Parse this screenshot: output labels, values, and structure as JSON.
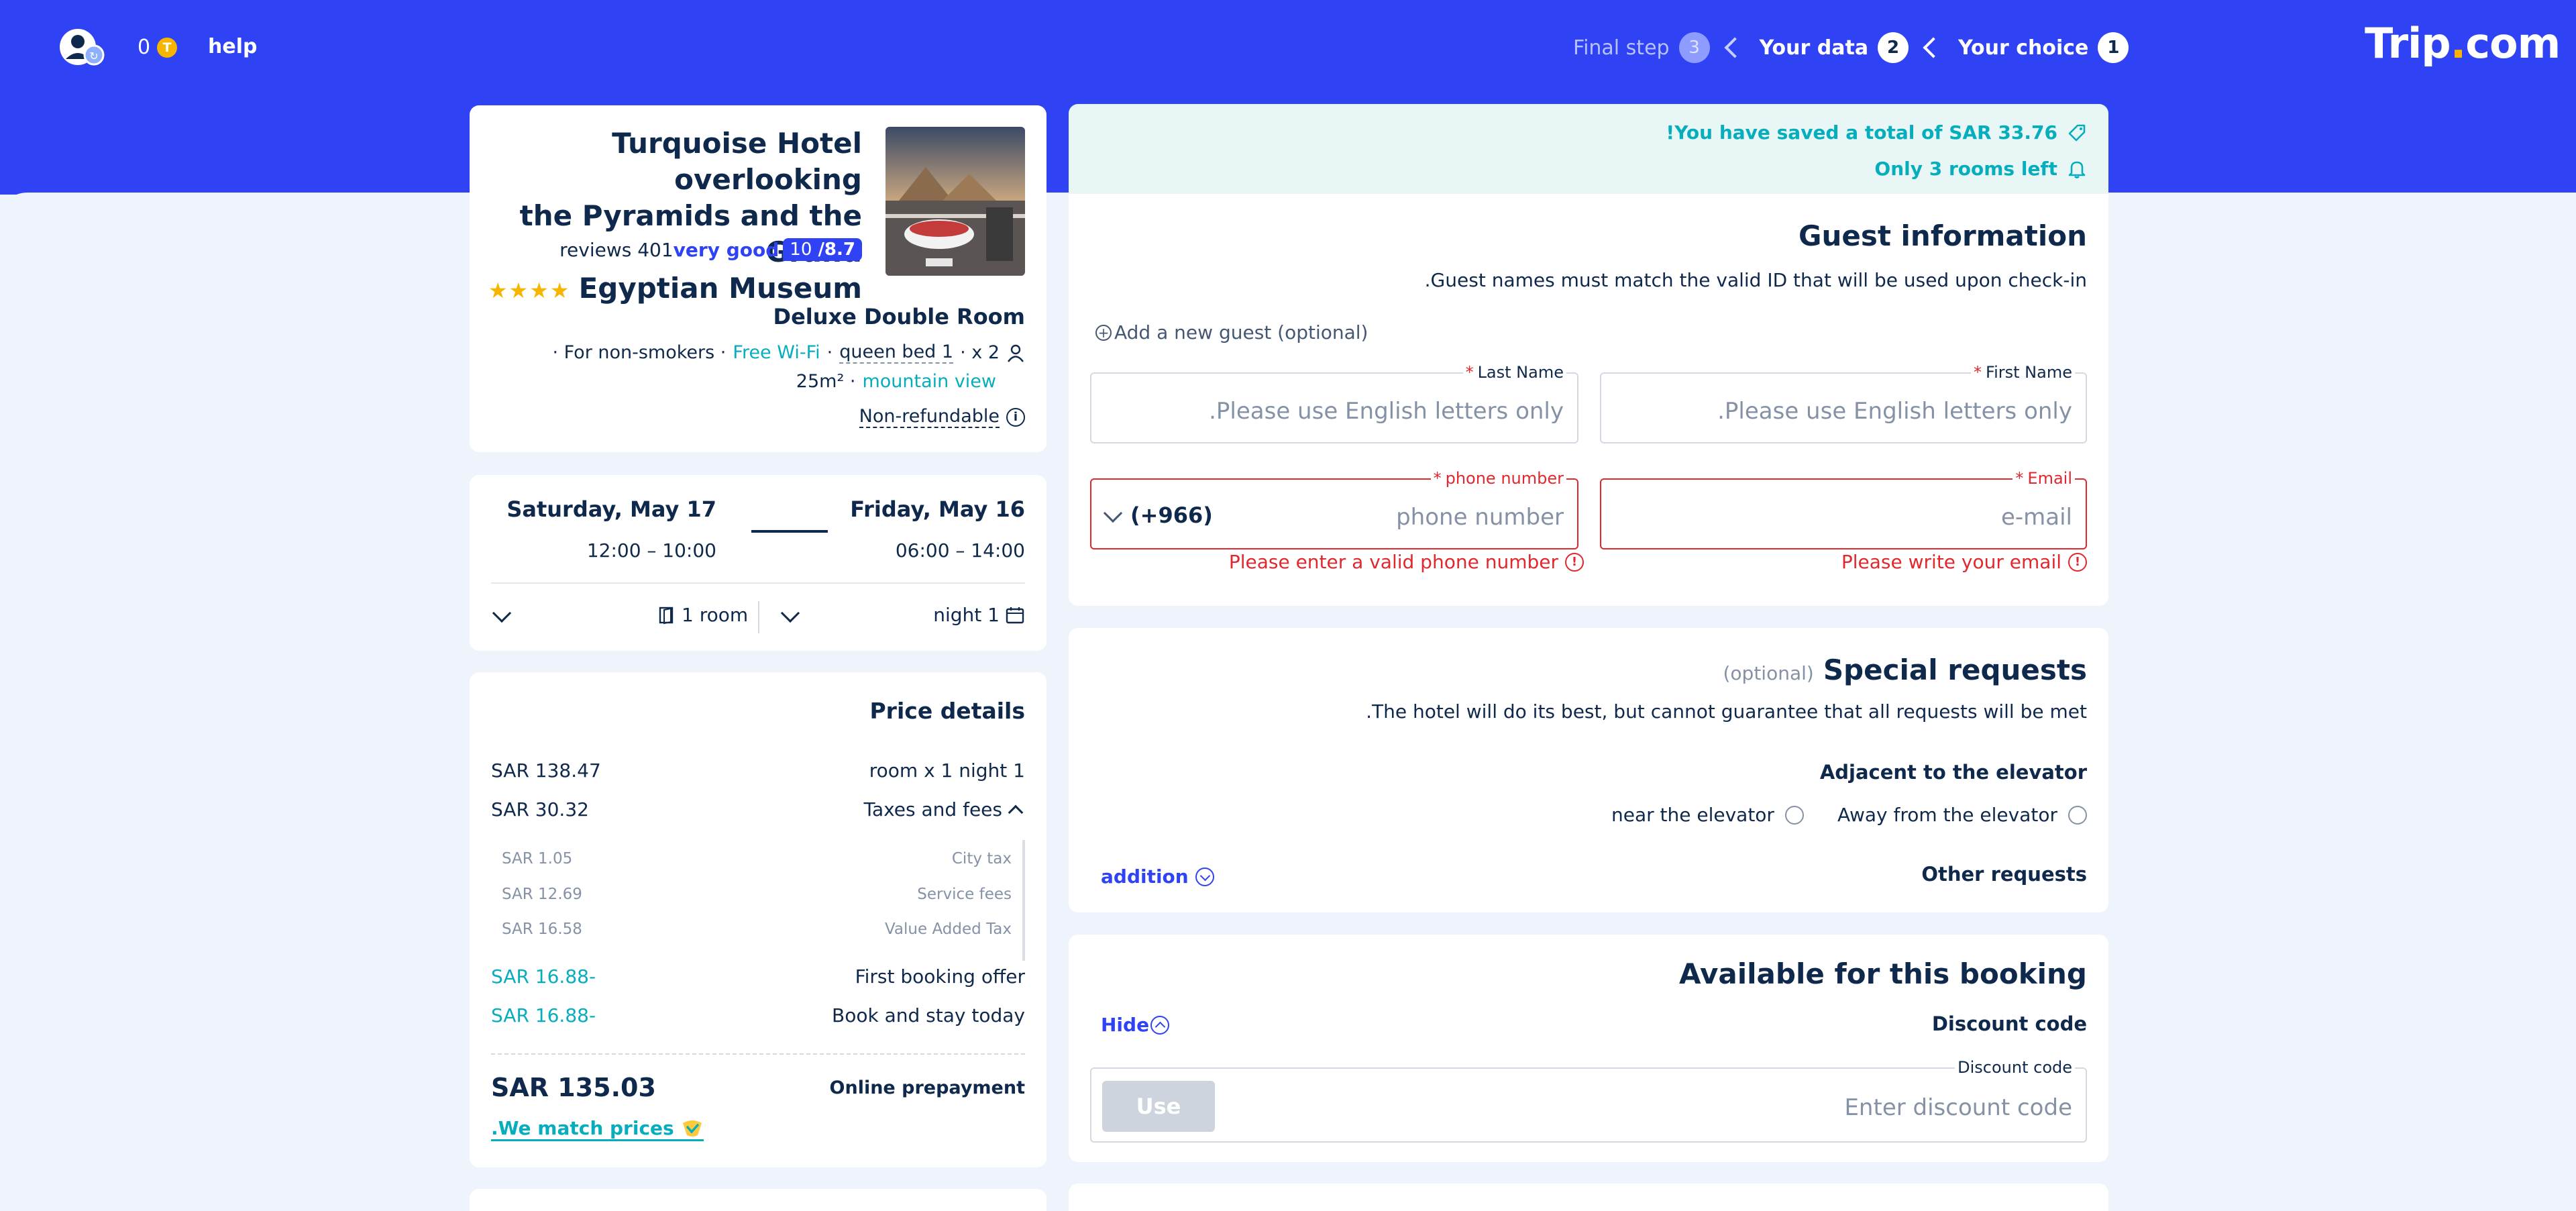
{
  "topbar": {
    "coins": "0",
    "coin_symbol": "T",
    "help": "help",
    "logo_main": "Trip",
    "logo_dot": ".",
    "logo_tail": "com",
    "steps": [
      {
        "label": "Final step",
        "num": "3"
      },
      {
        "label": "Your data",
        "num": "2"
      },
      {
        "label": "Your choice",
        "num": "1"
      }
    ]
  },
  "hotel": {
    "title_lines": [
      "Turquoise Hotel overlooking",
      "the Pyramids and the Grand",
      "Egyptian Museum"
    ],
    "stars": "★★★★",
    "reviews": "reviews 401",
    "rating_text": "very good",
    "score_max": "10",
    "score": "/8.7",
    "room_name": "Deluxe Double Room",
    "amenities": {
      "smoking": "· For non-smokers ·",
      "wifi": "Free Wi-Fi",
      "sep": "·",
      "bed": "queen bed 1",
      "guests": "· x 2",
      "size": "25m² ·",
      "view": "mountain view"
    },
    "refund": "Non-refundable",
    "refund_icon": "i"
  },
  "dates": {
    "checkin_day": "Saturday, May 17",
    "checkin_time": "12:00 – 10:00",
    "checkout_day": "Friday, May 16",
    "checkout_time": "06:00 – 14:00",
    "rooms": "1 room",
    "nights": "night 1"
  },
  "price": {
    "title": "Price details",
    "rows": [
      {
        "amount": "SAR 138.47",
        "label": "room x 1 night 1"
      },
      {
        "amount": "SAR 30.32",
        "label": "Taxes and fees"
      }
    ],
    "taxes": [
      {
        "amount": "SAR 1.05",
        "label": "City tax"
      },
      {
        "amount": "SAR 12.69",
        "label": "Service fees"
      },
      {
        "amount": "SAR 16.58",
        "label": "Value Added Tax"
      }
    ],
    "discounts": [
      {
        "amount": "SAR 16.88-",
        "label": "First booking offer"
      },
      {
        "amount": "SAR 16.88-",
        "label": "Book and stay today"
      }
    ],
    "total": "SAR 135.03",
    "prepay": "Online prepayment",
    "match": ".We match prices"
  },
  "savings": {
    "saved": "!You have saved a total of SAR 33.76",
    "rooms_left": "Only 3 rooms left"
  },
  "guest": {
    "title": "Guest information",
    "subtitle": ".Guest names must match the valid ID that will be used upon check-in",
    "add_guest": "Add a new guest (optional)",
    "plus": "+",
    "last_name_label": "Last Name",
    "first_name_label": "First Name",
    "required_mark": "*",
    "name_placeholder": ".Please use English letters only",
    "phone_label": "phone number",
    "phone_code": "(+966)",
    "phone_placeholder": "phone number",
    "phone_error": "Please enter a valid phone number",
    "email_label": "Email",
    "email_placeholder": "e-mail",
    "email_error": "Please write your email",
    "error_icon": "!"
  },
  "special": {
    "optional": "(optional)",
    "title": "Special requests",
    "subtitle": ".The hotel will do its best, but cannot guarantee that all requests will be met",
    "elevator_title": "Adjacent to the elevator",
    "option_near": "near the elevator",
    "option_away": "Away from the elevator",
    "addition": "addition",
    "other": "Other requests"
  },
  "booking": {
    "title": "Available for this booking",
    "hide": "Hide",
    "discount_title": "Discount code",
    "discount_label": "Discount code",
    "discount_placeholder": "Enter discount code",
    "use": "Use"
  },
  "colors": {
    "brand_blue": "#2f43f5",
    "teal": "#06aebd",
    "error_red": "#e0282e",
    "star_gold": "#f7b500"
  }
}
